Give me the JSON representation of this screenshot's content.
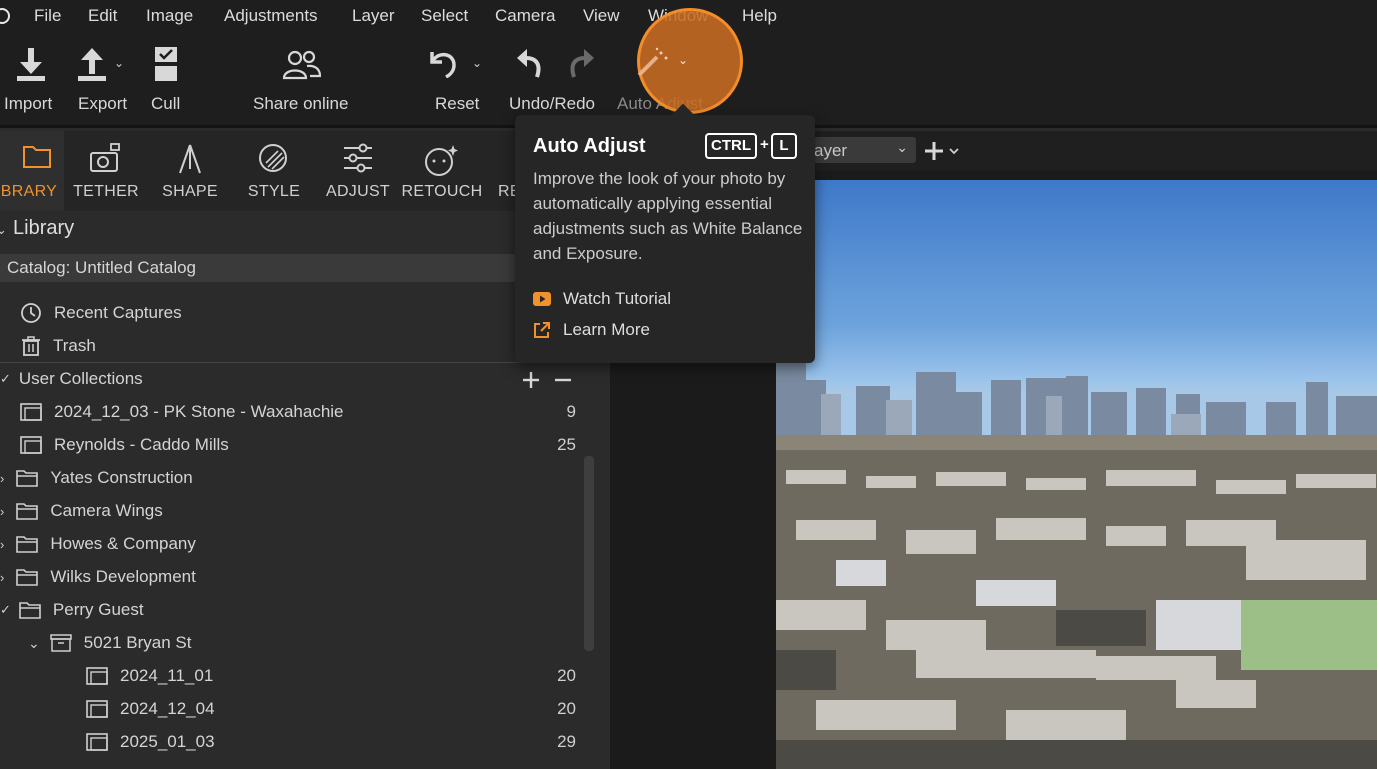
{
  "menu": {
    "items": [
      "File",
      "Edit",
      "Image",
      "Adjustments",
      "Layer",
      "Select",
      "Camera",
      "View",
      "Window",
      "Help"
    ]
  },
  "toolbar": {
    "import": "Import",
    "export": "Export",
    "cull": "Cull",
    "share": "Share online",
    "reset": "Reset",
    "undo_redo": "Undo/Redo",
    "auto_adjust": "Auto Adjust"
  },
  "tabs": [
    "LIBRARY",
    "TETHER",
    "SHAPE",
    "STYLE",
    "ADJUST",
    "RETOUCH",
    "RE"
  ],
  "library": {
    "title": "Library",
    "catalog": "Catalog: Untitled Catalog",
    "recent": "Recent Captures",
    "trash": "Trash",
    "user_collections": "User Collections",
    "items": [
      {
        "label": "2024_12_03 - PK Stone - Waxahachie",
        "count": "9"
      },
      {
        "label": "Reynolds - Caddo Mills",
        "count": "25"
      },
      {
        "label": "Yates Construction",
        "count": ""
      },
      {
        "label": "Camera Wings",
        "count": ""
      },
      {
        "label": "Howes & Company",
        "count": ""
      },
      {
        "label": "Wilks Development",
        "count": ""
      },
      {
        "label": "Perry Guest",
        "count": ""
      },
      {
        "label": "5021 Bryan St",
        "count": ""
      },
      {
        "label": "2024_11_01",
        "count": "20"
      },
      {
        "label": "2024_12_04",
        "count": "20"
      },
      {
        "label": "2025_01_03",
        "count": "29"
      }
    ]
  },
  "viewer": {
    "layer_select": "ayer"
  },
  "tooltip": {
    "title": "Auto Adjust",
    "key1": "CTRL",
    "plus": "+",
    "key2": "L",
    "body": "Improve the look of your photo by automatically applying essential adjustments such as White Balance and Exposure.",
    "watch": "Watch Tutorial",
    "learn": "Learn More"
  },
  "colors": {
    "accent": "#f0912c",
    "highlight": "#c96c23"
  }
}
